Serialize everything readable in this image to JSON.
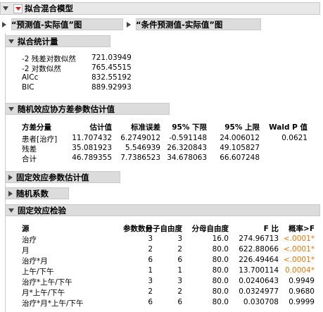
{
  "main_title": "拟合混合模型",
  "graph_buttons": [
    "“预测值-实际值”图",
    "“条件预测值-实际值”图"
  ],
  "fit_stats": {
    "title": "拟合统计量",
    "rows": [
      {
        "label": "-2 残差对数似然",
        "value": "721.03949"
      },
      {
        "label": "-2 对数似然",
        "value": "765.45515"
      },
      {
        "label": "AICc",
        "value": "832.55192"
      },
      {
        "label": "BIC",
        "value": "889.92993"
      }
    ]
  },
  "random_cov": {
    "title": "随机效应协方差参数估计值",
    "headers": [
      "方差分量",
      "估计值",
      "标准误差",
      "95% 下限",
      "95% 上限",
      "Wald P 值"
    ],
    "rows": [
      [
        "患者[治疗]",
        "11.707432",
        "6.2749012",
        "-0.591148",
        "24.006012",
        "0.0621"
      ],
      [
        "残差",
        "35.081923",
        "5.546939",
        "26.320843",
        "49.105827",
        ""
      ],
      [
        "合计",
        "46.789355",
        "7.7386523",
        "34.678063",
        "66.607248",
        ""
      ]
    ]
  },
  "fixed_params_title": "固定效应参数估计值",
  "random_coef_title": "随机系数",
  "fixed_tests": {
    "title": "固定效应检验",
    "headers": [
      "源",
      "参数数目",
      "分子自由度",
      "分母自由度",
      "F 比",
      "概率>F"
    ],
    "rows": [
      [
        "治疗",
        "3",
        "3",
        "16.0",
        "274.96713",
        "<.0001*"
      ],
      [
        "月",
        "2",
        "2",
        "80.0",
        "622.88066",
        "<.0001*"
      ],
      [
        "治疗*月",
        "6",
        "6",
        "80.0",
        "226.49464",
        "<.0001*"
      ],
      [
        "上午/下午",
        "1",
        "1",
        "80.0",
        "13.700114",
        "0.0004*"
      ],
      [
        "治疗*上午/下午",
        "3",
        "3",
        "80.0",
        "0.0240643",
        "0.9949"
      ],
      [
        "月*上午/下午",
        "2",
        "2",
        "80.0",
        "0.0324977",
        "0.9680"
      ],
      [
        "治疗*月*上午/下午",
        "6",
        "6",
        "80.0",
        "0.030708",
        "0.9999"
      ]
    ]
  }
}
